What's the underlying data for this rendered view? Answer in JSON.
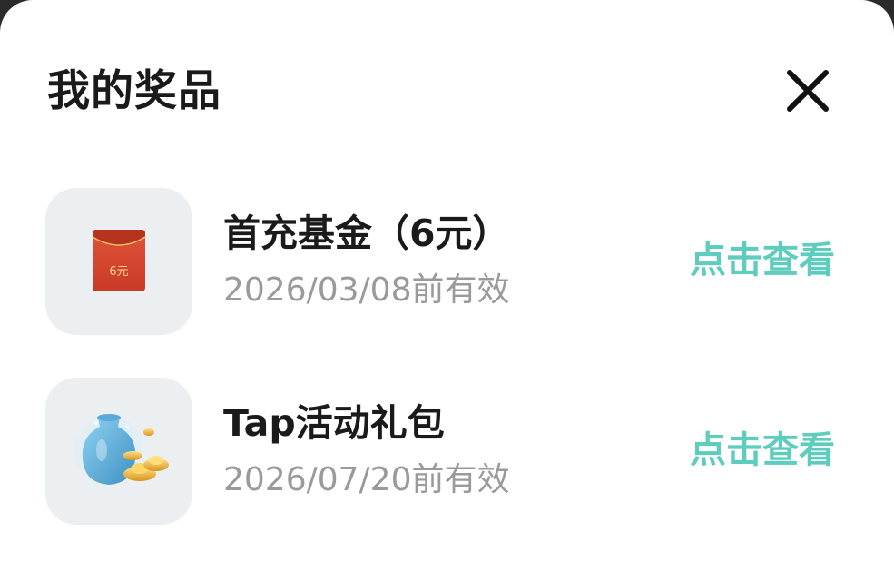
{
  "dialog": {
    "title": "我的奖品",
    "close_icon": "close-icon"
  },
  "prizes": [
    {
      "name": "首充基金（6元）",
      "expiry": "2026/03/08前有效",
      "action_label": "点击查看",
      "thumb_icon": "red-envelope-icon",
      "thumb_label": "6元"
    },
    {
      "name": "Tap活动礼包",
      "expiry": "2026/07/20前有效",
      "action_label": "点击查看",
      "thumb_icon": "treasure-vase-gold-ingot-icon"
    }
  ],
  "colors": {
    "accent": "#5ecdbd",
    "title_text": "#1a1a1a",
    "muted_text": "#9a9a9a",
    "thumb_bg": "#eceff1",
    "envelope_red": "#d9452e",
    "gold": "#f2b630"
  }
}
